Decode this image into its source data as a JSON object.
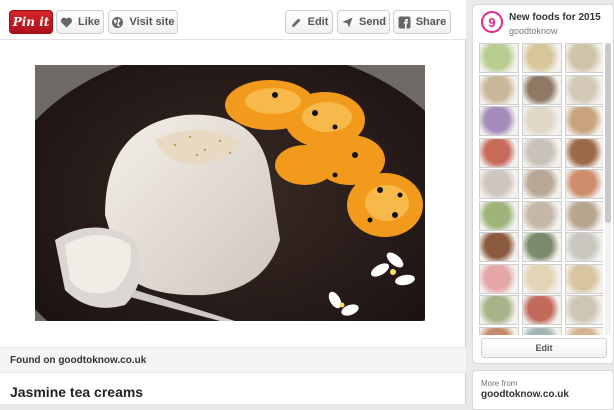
{
  "toolbar": {
    "pin_it": "Pin it",
    "like": "Like",
    "visit_site": "Visit site",
    "edit": "Edit",
    "send": "Send",
    "share": "Share"
  },
  "pin": {
    "found_on": "Found on goodtoknow.co.uk",
    "title": "Jasmine tea creams"
  },
  "board": {
    "avatar_text": "9",
    "title": "New foods for 2015",
    "owner": "goodtoknow",
    "edit_label": "Edit",
    "thumb_colors": [
      "#b7cc8e",
      "#d7c79b",
      "#cfc3a8",
      "#c9b79a",
      "#8e7a64",
      "#d3c9b6",
      "#a58bb9",
      "#e0d7c4",
      "#c9a37c",
      "#c76a5b",
      "#c8c2b8",
      "#9d6a48",
      "#cfc7bf",
      "#b9a694",
      "#cf8d6b",
      "#9fb37a",
      "#c6b8a6",
      "#b7a590",
      "#8b5a3f",
      "#7b8a6a",
      "#c9c6c0",
      "#e5a6a8",
      "#e3d4b5",
      "#d8c5a0",
      "#a7b388",
      "#c26a5c",
      "#ccc7b4",
      "#c58a6a",
      "#a0b6b3",
      "#d4b38e"
    ]
  },
  "more_from": {
    "label": "More from",
    "source": "goodtoknow.co.uk"
  }
}
